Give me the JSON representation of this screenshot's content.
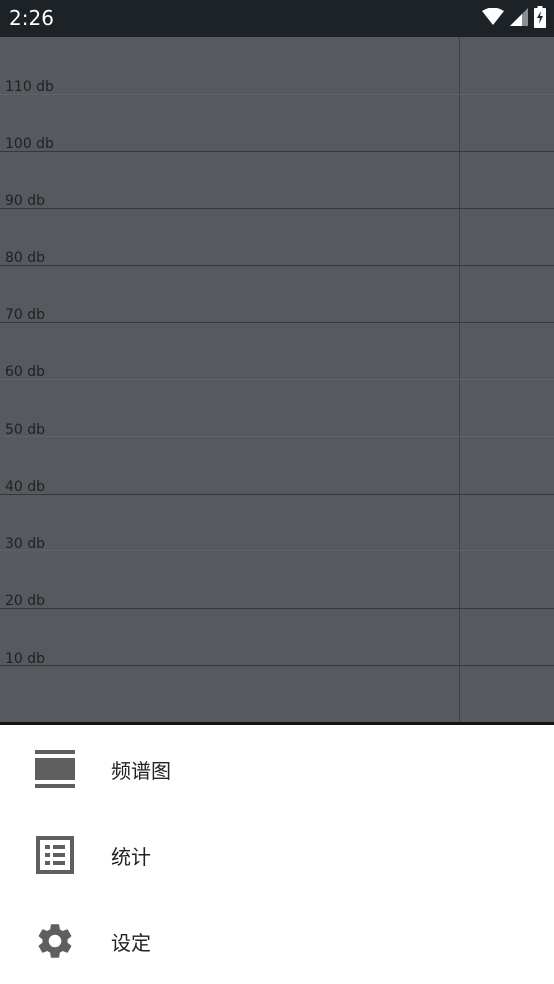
{
  "status_bar": {
    "time": "2:26"
  },
  "chart": {
    "y_labels": [
      "110 db",
      "100 db",
      "90 db",
      "80 db",
      "70 db",
      "60 db",
      "50 db",
      "40 db",
      "30 db",
      "20 db",
      "10 db"
    ]
  },
  "menu": {
    "items": [
      {
        "label": "频谱图",
        "icon": "spectrum-icon"
      },
      {
        "label": "统计",
        "icon": "list-icon"
      },
      {
        "label": "设定",
        "icon": "gear-icon"
      }
    ]
  },
  "colors": {
    "status_bar_bg": "#1c2226",
    "chart_bg": "#565a5e",
    "sheet_bg": "#ffffff",
    "icon_color": "#5f5f5f"
  }
}
